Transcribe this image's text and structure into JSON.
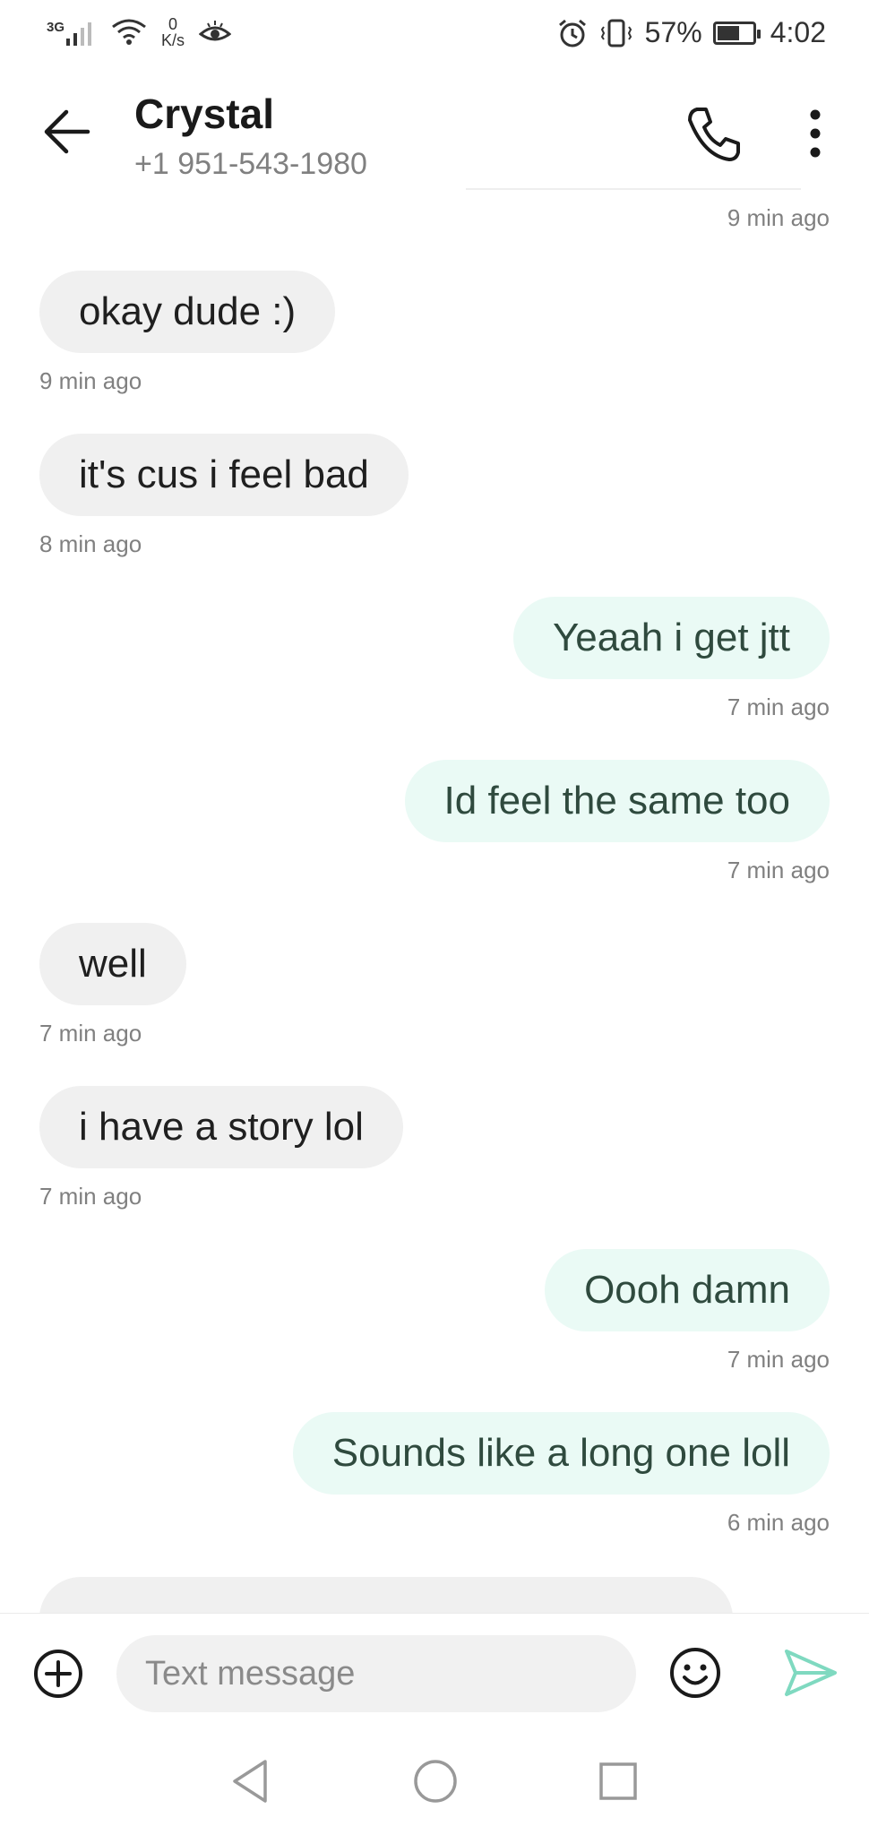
{
  "status_bar": {
    "network_type": "3G",
    "speed_value": "0",
    "speed_unit": "K/s",
    "battery_percent": "57%",
    "battery_level": 0.57,
    "time": "4:02"
  },
  "header": {
    "contact_name": "Crystal",
    "contact_number": "+1 951-543-1980"
  },
  "conversation": {
    "top_timestamp": "9 min ago",
    "messages": [
      {
        "direction": "in",
        "text": "okay dude :)",
        "time": "9 min ago"
      },
      {
        "direction": "in",
        "text": "it's cus i feel bad",
        "time": "8 min ago"
      },
      {
        "direction": "out",
        "text": "Yeaah i get jtt",
        "time": "7 min ago"
      },
      {
        "direction": "out",
        "text": "Id feel the same too",
        "time": "7 min ago"
      },
      {
        "direction": "in",
        "text": "well",
        "time": "7 min ago"
      },
      {
        "direction": "in",
        "text": "i have a story lol",
        "time": "7 min ago"
      },
      {
        "direction": "out",
        "text": "Oooh damn",
        "time": "7 min ago"
      },
      {
        "direction": "out",
        "text": "Sounds like a long one loll",
        "time": "6 min ago"
      }
    ]
  },
  "composer": {
    "placeholder": "Text message"
  },
  "icons": {
    "back": "arrow-left-icon",
    "call": "phone-icon",
    "more": "more-vertical-icon",
    "add": "plus-circle-icon",
    "emoji": "smiley-icon",
    "send": "send-icon"
  },
  "colors": {
    "incoming_bubble": "#f0f0f0",
    "outgoing_bubble": "#eafaf5",
    "outgoing_text": "#2f4a3e",
    "send_accent": "#7fd9c0"
  }
}
